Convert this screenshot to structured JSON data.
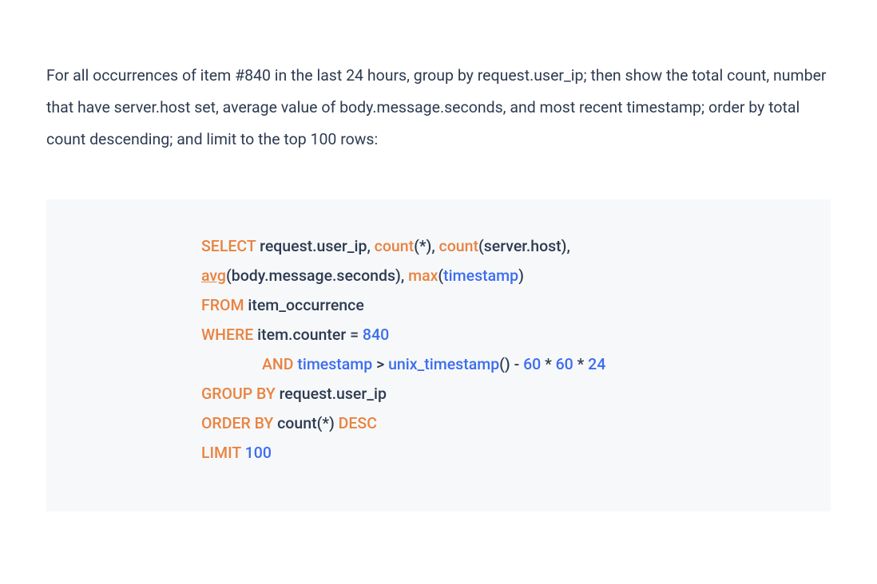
{
  "description": "For all occurrences of item #840 in the last 24 hours, group by request.user_ip; then show the total count, number that have server.host set, average value of body.message.seconds, and most recent timestamp; order by total count descending; and limit to the top 100 rows:",
  "code": {
    "line1": {
      "k_select": "SELECT",
      "f_request_user_ip": " request.user_ip",
      "comma1": ", ",
      "f_count1": "count",
      "paren_star1": "(*)",
      "comma2": ", ",
      "f_count2": "count",
      "paren_open": "(",
      "f_server_host": "server.host",
      "paren_close_comma": "),"
    },
    "line2": {
      "f_avg": "avg",
      "paren_open": "(",
      "f_body_msg": "body.message.seconds",
      "paren_close": ")",
      "comma": ", ",
      "f_max": "max",
      "paren_open2": "(",
      "f_timestamp": "timestamp",
      "paren_close2": ")"
    },
    "line3": {
      "k_from": "FROM",
      "t_item_occurrence": " item_occurrence"
    },
    "line4": {
      "k_where": "WHERE",
      "cond": " item.counter = ",
      "v_840": "840"
    },
    "line5": {
      "k_and": "AND",
      "sp": " ",
      "f_timestamp": "timestamp",
      "gt": " > ",
      "f_unix": "unix_timestamp",
      "parens": "()",
      "minus": " - ",
      "n60a": "60",
      "star1": " * ",
      "n60b": "60",
      "star2": " * ",
      "n24": "24"
    },
    "line6": {
      "k_group_by": "GROUP BY",
      "f_request_user_ip": " request.user_ip"
    },
    "line7": {
      "k_order_by": "ORDER BY",
      "f_count": " count",
      "paren_star": "(*) ",
      "k_desc": "DESC"
    },
    "line8": {
      "k_limit": "LIMIT",
      "sp": " ",
      "n100": "100"
    }
  }
}
